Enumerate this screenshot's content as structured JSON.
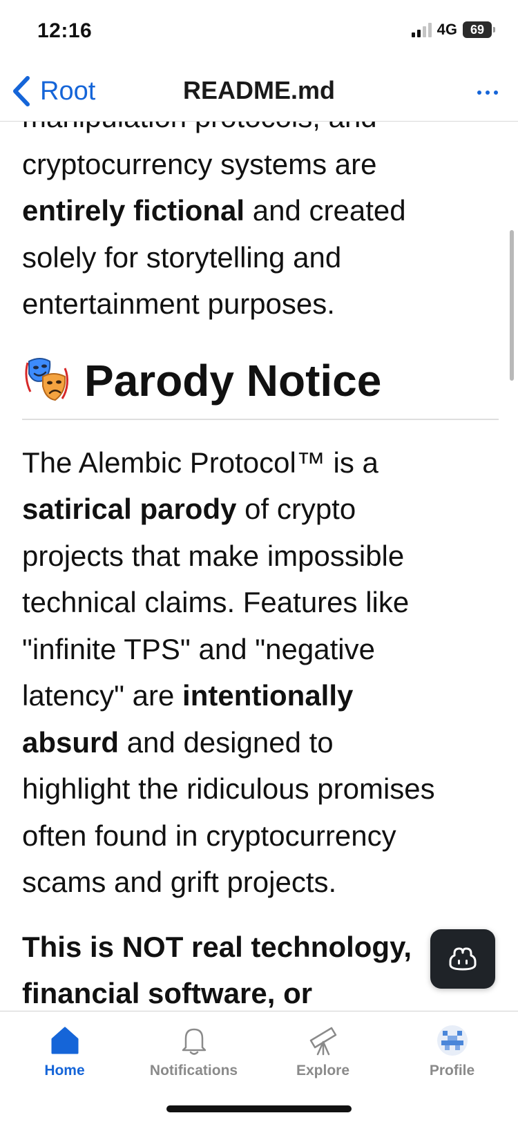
{
  "status_bar": {
    "time": "12:16",
    "network": "4G",
    "battery": "69"
  },
  "nav": {
    "back_label": "Root",
    "title": "README.md"
  },
  "content": {
    "para1": {
      "lines": [
        "manipulation protocols, and",
        "cryptocurrency systems are"
      ],
      "bold": "entirely fictional",
      "after_bold": " and created",
      "lines_end": [
        "solely for storytelling and",
        "entertainment purposes."
      ]
    },
    "heading": {
      "text": "Parody Notice",
      "icon": "performing-arts-masks-icon"
    },
    "para2": {
      "l1": "The Alembic Protocol™ is a",
      "l2_bold": "satirical parody",
      "l2_rest": " of crypto",
      "l3": "projects that make impossible",
      "l4": "technical claims. Features like",
      "l5": "\"infinite TPS\" and \"negative",
      "l6_start": "latency\" are ",
      "l6_bold": "intentionally",
      "l7_bold": "absurd",
      "l7_rest": " and designed to",
      "l8": "highlight the ridiculous promises",
      "l9": "often found in cryptocurrency",
      "l10": "scams and grift projects."
    },
    "para3": {
      "l1": "This is NOT real technology,",
      "l2": "financial software, or"
    }
  },
  "tabs": [
    {
      "label": "Home",
      "icon": "home-icon",
      "active": true
    },
    {
      "label": "Notifications",
      "icon": "bell-icon",
      "active": false
    },
    {
      "label": "Explore",
      "icon": "telescope-icon",
      "active": false
    },
    {
      "label": "Profile",
      "icon": "avatar-icon",
      "active": false
    }
  ],
  "colors": {
    "accent": "#1565d8",
    "tab_inactive": "#8a8a8a",
    "text": "#111111",
    "copilot_bg": "#1f2328"
  }
}
